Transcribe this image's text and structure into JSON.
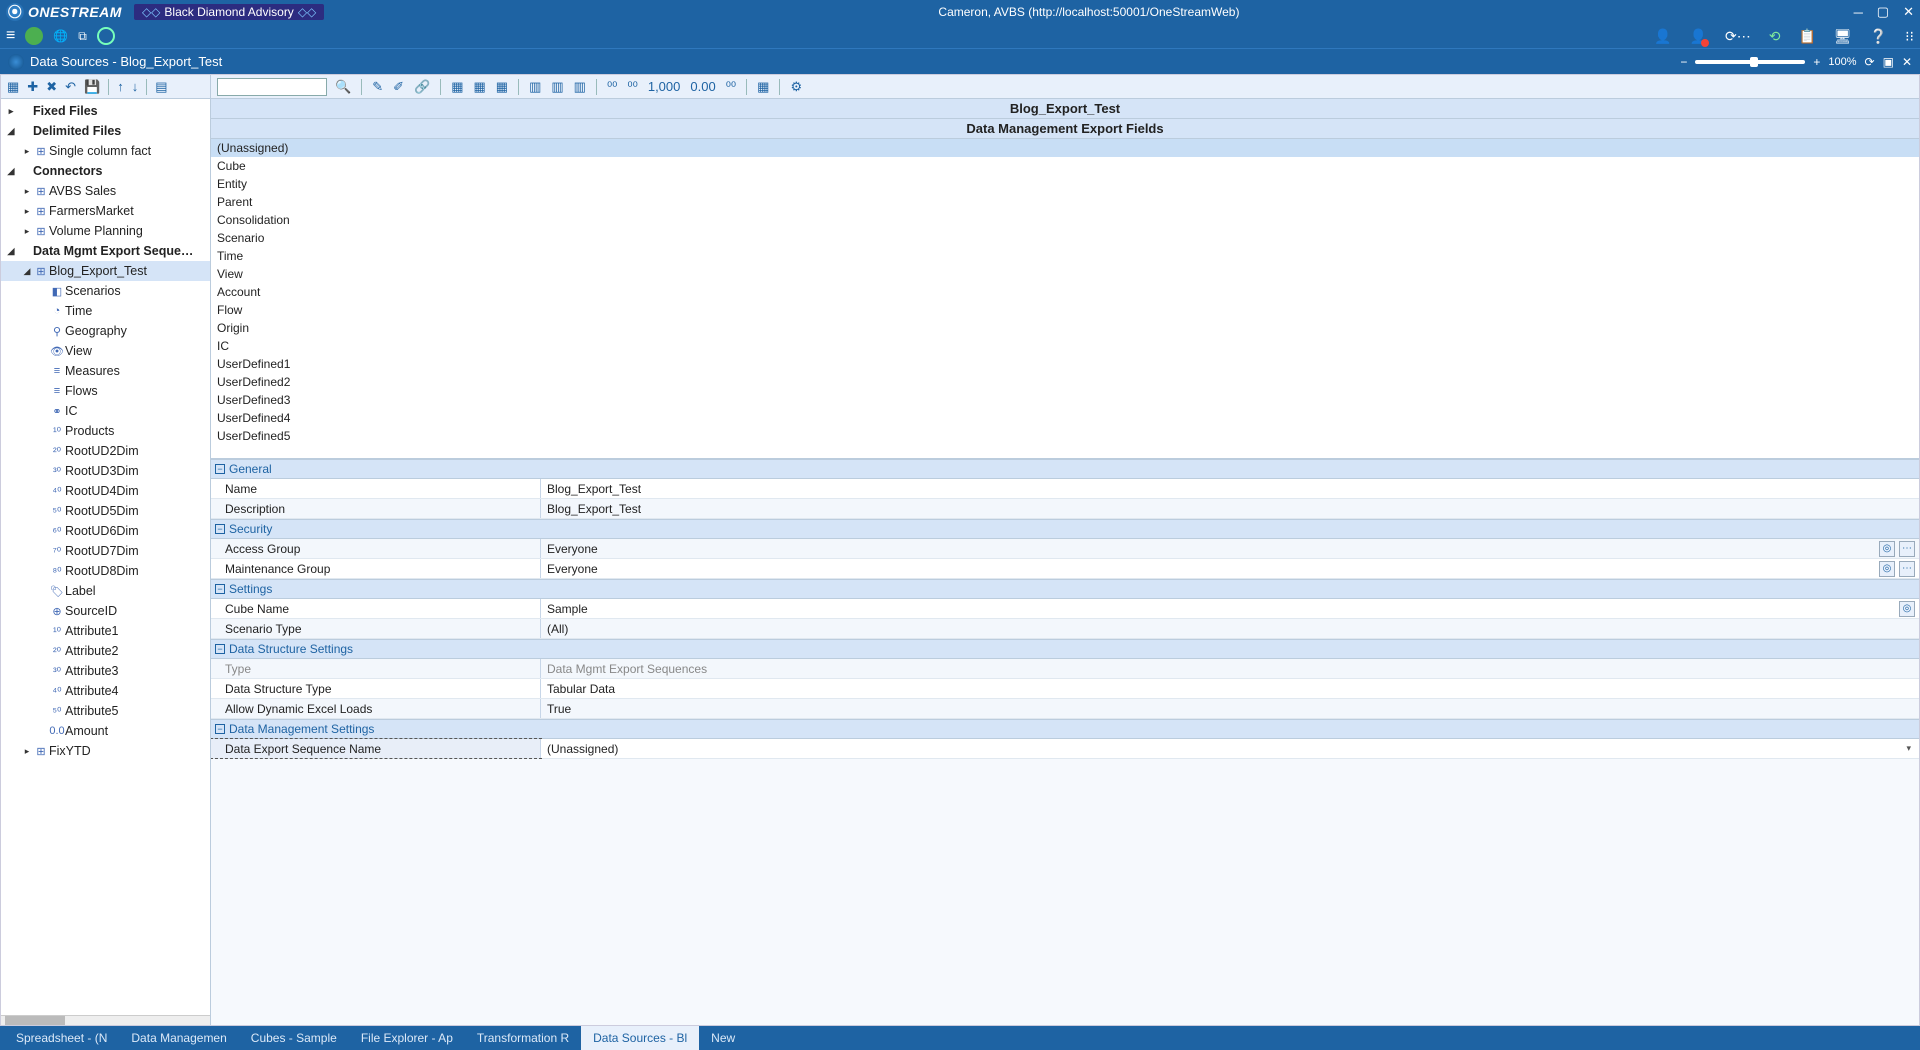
{
  "titlebar": {
    "app": "ONESTREAM",
    "advisory": "Black Diamond Advisory",
    "center": "Cameron, AVBS (http://localhost:50001/OneStreamWeb)"
  },
  "tab": {
    "title": "Data Sources - Blog_Export_Test",
    "zoom": "100%"
  },
  "tree": [
    {
      "depth": 0,
      "caret": "▸",
      "label": "Fixed Files",
      "bold": true,
      "icon": ""
    },
    {
      "depth": 0,
      "caret": "◢",
      "label": "Delimited Files",
      "bold": true,
      "icon": ""
    },
    {
      "depth": 1,
      "caret": "▸",
      "label": "Single column fact",
      "icon": "⊞"
    },
    {
      "depth": 0,
      "caret": "◢",
      "label": "Connectors",
      "bold": true,
      "icon": ""
    },
    {
      "depth": 1,
      "caret": "▸",
      "label": "AVBS Sales",
      "icon": "⊞"
    },
    {
      "depth": 1,
      "caret": "▸",
      "label": "FarmersMarket",
      "icon": "⊞"
    },
    {
      "depth": 1,
      "caret": "▸",
      "label": "Volume Planning",
      "icon": "⊞"
    },
    {
      "depth": 0,
      "caret": "◢",
      "label": "Data Mgmt Export Seque…",
      "bold": true,
      "icon": ""
    },
    {
      "depth": 1,
      "caret": "◢",
      "label": "Blog_Export_Test",
      "icon": "⊞",
      "selected": true
    },
    {
      "depth": 2,
      "caret": "",
      "label": "Scenarios",
      "icon": "◧"
    },
    {
      "depth": 2,
      "caret": "",
      "label": "Time",
      "icon": "◔"
    },
    {
      "depth": 2,
      "caret": "",
      "label": "Geography",
      "icon": "⚲"
    },
    {
      "depth": 2,
      "caret": "",
      "label": "View",
      "icon": "👁"
    },
    {
      "depth": 2,
      "caret": "",
      "label": "Measures",
      "icon": "≡"
    },
    {
      "depth": 2,
      "caret": "",
      "label": "Flows",
      "icon": "≡"
    },
    {
      "depth": 2,
      "caret": "",
      "label": "IC",
      "icon": "⚭"
    },
    {
      "depth": 2,
      "caret": "",
      "label": "Products",
      "icon": "¹⁰"
    },
    {
      "depth": 2,
      "caret": "",
      "label": "RootUD2Dim",
      "icon": "²⁰"
    },
    {
      "depth": 2,
      "caret": "",
      "label": "RootUD3Dim",
      "icon": "³⁰"
    },
    {
      "depth": 2,
      "caret": "",
      "label": "RootUD4Dim",
      "icon": "⁴⁰"
    },
    {
      "depth": 2,
      "caret": "",
      "label": "RootUD5Dim",
      "icon": "⁵⁰"
    },
    {
      "depth": 2,
      "caret": "",
      "label": "RootUD6Dim",
      "icon": "⁶⁰"
    },
    {
      "depth": 2,
      "caret": "",
      "label": "RootUD7Dim",
      "icon": "⁷⁰"
    },
    {
      "depth": 2,
      "caret": "",
      "label": "RootUD8Dim",
      "icon": "⁸⁰"
    },
    {
      "depth": 2,
      "caret": "",
      "label": "Label",
      "icon": "🏷"
    },
    {
      "depth": 2,
      "caret": "",
      "label": "SourceID",
      "icon": "⊕"
    },
    {
      "depth": 2,
      "caret": "",
      "label": "Attribute1",
      "icon": "¹⁰"
    },
    {
      "depth": 2,
      "caret": "",
      "label": "Attribute2",
      "icon": "²⁰"
    },
    {
      "depth": 2,
      "caret": "",
      "label": "Attribute3",
      "icon": "³⁰"
    },
    {
      "depth": 2,
      "caret": "",
      "label": "Attribute4",
      "icon": "⁴⁰"
    },
    {
      "depth": 2,
      "caret": "",
      "label": "Attribute5",
      "icon": "⁵⁰"
    },
    {
      "depth": 2,
      "caret": "",
      "label": "Amount",
      "icon": "0.0"
    },
    {
      "depth": 1,
      "caret": "▸",
      "label": "FixYTD",
      "icon": "⊞"
    }
  ],
  "headers": {
    "h1": "Blog_Export_Test",
    "h2": "Data Management Export Fields"
  },
  "fields": [
    {
      "label": "(Unassigned)",
      "selected": true
    },
    {
      "label": "Cube"
    },
    {
      "label": "Entity"
    },
    {
      "label": "Parent"
    },
    {
      "label": "Consolidation"
    },
    {
      "label": "Scenario"
    },
    {
      "label": "Time"
    },
    {
      "label": "View"
    },
    {
      "label": "Account"
    },
    {
      "label": "Flow"
    },
    {
      "label": "Origin"
    },
    {
      "label": "IC"
    },
    {
      "label": "UserDefined1"
    },
    {
      "label": "UserDefined2"
    },
    {
      "label": "UserDefined3"
    },
    {
      "label": "UserDefined4"
    },
    {
      "label": "UserDefined5"
    }
  ],
  "props": {
    "groups": [
      {
        "title": "General",
        "rows": [
          {
            "k": "Name",
            "v": "Blog_Export_Test"
          },
          {
            "k": "Description",
            "v": "Blog_Export_Test"
          }
        ]
      },
      {
        "title": "Security",
        "rows": [
          {
            "k": "Access Group",
            "v": "Everyone",
            "editBtns": true
          },
          {
            "k": "Maintenance Group",
            "v": "Everyone",
            "editBtns": true
          }
        ]
      },
      {
        "title": "Settings",
        "rows": [
          {
            "k": "Cube Name",
            "v": "Sample",
            "editBtns": "one"
          },
          {
            "k": "Scenario Type",
            "v": "(All)"
          }
        ]
      },
      {
        "title": "Data Structure Settings",
        "rows": [
          {
            "k": "Type",
            "v": "Data Mgmt Export Sequences",
            "dim": true
          },
          {
            "k": "Data Structure Type",
            "v": "Tabular Data"
          },
          {
            "k": "Allow Dynamic Excel Loads",
            "v": "True"
          }
        ]
      },
      {
        "title": "Data Management Settings",
        "rows": [
          {
            "k": "Data Export Sequence Name",
            "v": "(Unassigned)",
            "selected": true,
            "dd": true
          }
        ]
      }
    ]
  },
  "bottomtabs": [
    {
      "label": "Spreadsheet - (N"
    },
    {
      "label": "Data Managemen"
    },
    {
      "label": "Cubes - Sample"
    },
    {
      "label": "File Explorer - Ap"
    },
    {
      "label": "Transformation R"
    },
    {
      "label": "Data Sources - Bl",
      "active": true
    },
    {
      "label": "New"
    }
  ]
}
